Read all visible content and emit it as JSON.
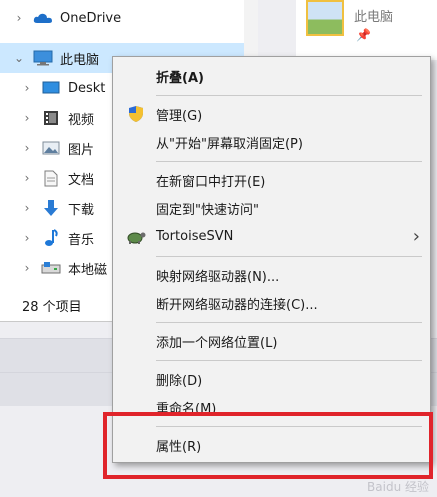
{
  "explorer": {
    "nav": [
      {
        "label": "OneDrive",
        "chevron": "›",
        "icon": "onedrive-icon"
      },
      {
        "label": "此电脑",
        "chevron": "⌄",
        "icon": "this-pc-icon"
      },
      {
        "label": "Deskt",
        "chevron": "›",
        "icon": "desktop-icon"
      },
      {
        "label": "视频",
        "chevron": "›",
        "icon": "video-icon"
      },
      {
        "label": "图片",
        "chevron": "›",
        "icon": "pictures-icon"
      },
      {
        "label": "文档",
        "chevron": "›",
        "icon": "documents-icon"
      },
      {
        "label": "下载",
        "chevron": "›",
        "icon": "download-icon"
      },
      {
        "label": "音乐",
        "chevron": "›",
        "icon": "music-icon"
      },
      {
        "label": "本地磁",
        "chevron": "›",
        "icon": "local-disk-icon"
      }
    ],
    "status": "28 个项目"
  },
  "right_pane": {
    "thumbnail_label": "此电脑",
    "pin": "📌"
  },
  "context_menu": {
    "items": [
      {
        "label": "折叠(A)",
        "bold": true
      },
      {
        "label": "管理(G)",
        "icon": "shield-icon"
      },
      {
        "label": "从\"开始\"屏幕取消固定(P)"
      },
      {
        "label": "在新窗口中打开(E)"
      },
      {
        "label": "固定到\"快速访问\""
      },
      {
        "label": "TortoiseSVN",
        "icon": "tortoisesvn-icon",
        "submenu": "›"
      },
      {
        "label": "映射网络驱动器(N)..."
      },
      {
        "label": "断开网络驱动器的连接(C)..."
      },
      {
        "label": "添加一个网络位置(L)"
      },
      {
        "label": "删除(D)"
      },
      {
        "label": "重命名(M)"
      },
      {
        "label": "属性(R)"
      }
    ]
  },
  "watermark": "Baidu 经验",
  "colors": {
    "selection": "#cce8ff",
    "highlight": "#e0242b",
    "menu_bg": "#f2f2f2"
  }
}
